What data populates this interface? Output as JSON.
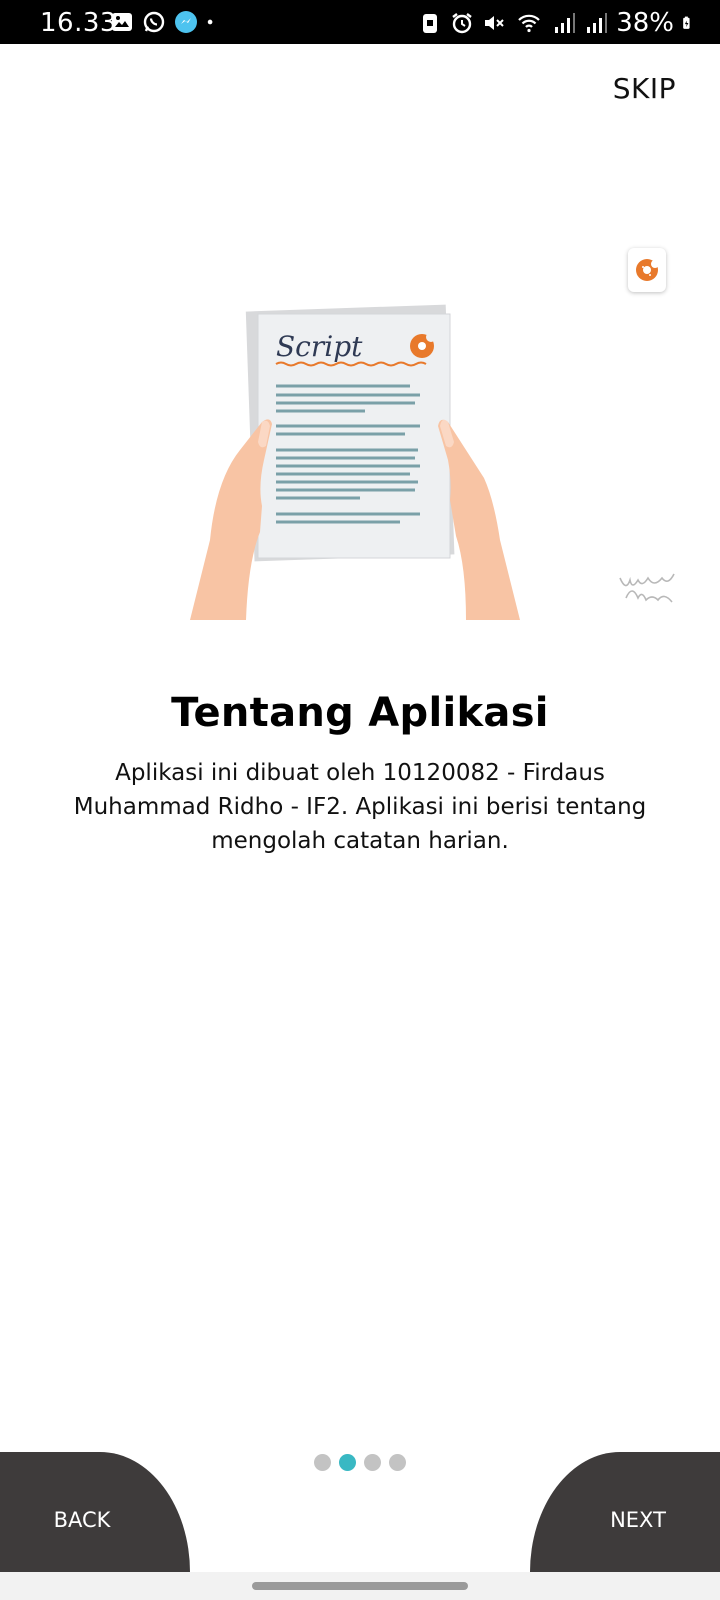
{
  "status_bar": {
    "time": "16.33",
    "battery": "38%",
    "left_icons": [
      "gallery-icon",
      "whatsapp-icon",
      "messenger-icon",
      "dot-icon"
    ],
    "right_icons": [
      "screenshot-icon",
      "alarm-icon",
      "mute-icon",
      "wifi-icon",
      "signal-icon",
      "signal-icon",
      "battery-icon"
    ]
  },
  "header": {
    "skip_label": "SKIP"
  },
  "illustration": {
    "paper_heading": "Script",
    "accent_color": "#e8792b"
  },
  "content": {
    "title": "Tentang Aplikasi",
    "description": "Aplikasi ini dibuat oleh 10120082 - Firdaus Muhammad Ridho - IF2. Aplikasi ini berisi tentang mengolah catatan harian."
  },
  "pager": {
    "total": 4,
    "active_index": 1,
    "active_color": "#39b8c3",
    "inactive_color": "#c3c3c3"
  },
  "footer": {
    "back_label": "BACK",
    "next_label": "NEXT",
    "button_color": "#3e3b3b"
  }
}
